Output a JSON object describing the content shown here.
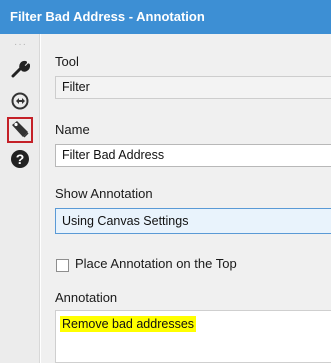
{
  "window": {
    "title": "Filter Bad Address - Annotation"
  },
  "sidebar": {
    "icons": [
      {
        "name": "wrench-icon",
        "active": false
      },
      {
        "name": "connection-icon",
        "active": false
      },
      {
        "name": "tag-icon",
        "active": true
      },
      {
        "name": "help-icon",
        "active": false
      }
    ]
  },
  "tool": {
    "label": "Tool",
    "value": "Filter"
  },
  "name": {
    "label": "Name",
    "value": "Filter Bad Address"
  },
  "show_annotation": {
    "label": "Show Annotation",
    "selected": "Using Canvas Settings"
  },
  "place_top": {
    "label": "Place Annotation on the Top",
    "checked": false
  },
  "annotation": {
    "label": "Annotation",
    "text": "Remove bad addresses",
    "highlight_color": "#ffff00"
  },
  "colors": {
    "title_bar": "#3d8fd4",
    "active_outline": "#c42027",
    "select_border": "#5a9ad6"
  }
}
